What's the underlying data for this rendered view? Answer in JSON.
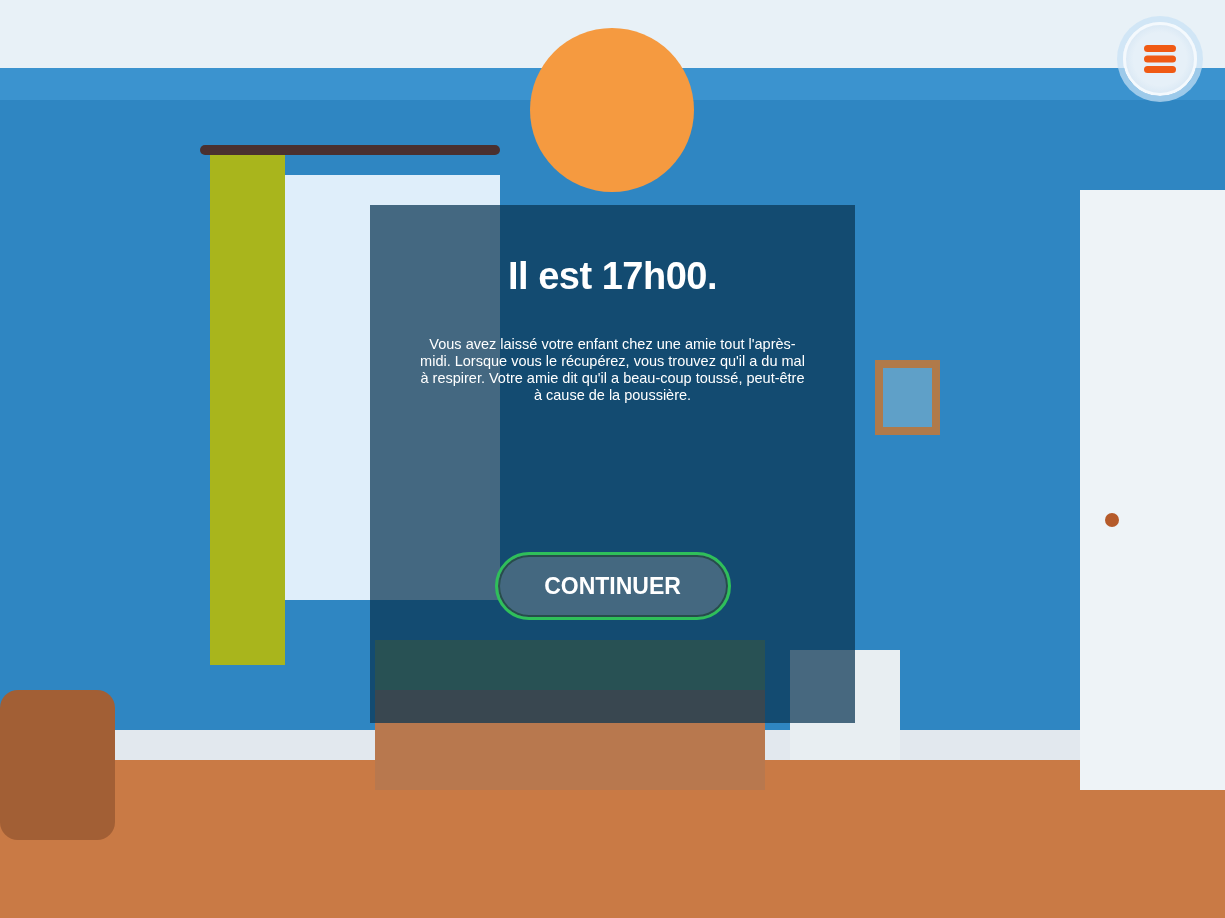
{
  "dialog": {
    "title": "Il est 17h00.",
    "message": "Vous avez laissé votre enfant chez une amie tout l'après-midi. Lorsque vous le récupérez, vous trouvez qu'il a du mal à respirer. Votre amie dit qu'il a beau-coup toussé, peut-être à cause de la poussière.",
    "button": "CONTINUER"
  }
}
